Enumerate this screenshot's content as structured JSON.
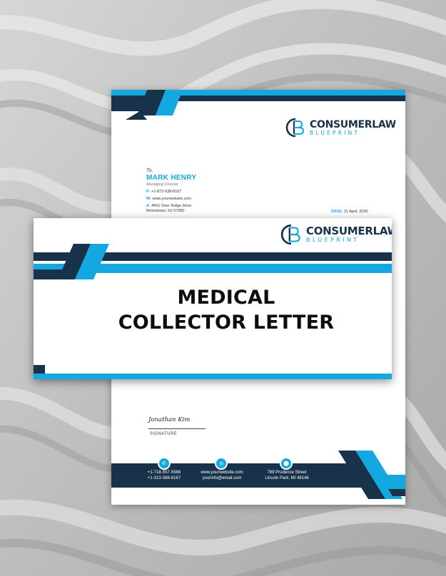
{
  "brand": {
    "name_line1": "CONSUMERLAW",
    "name_line2": "BLUEPRINT",
    "monogram": "CB"
  },
  "colors": {
    "accent": "#13a9e0",
    "navy": "#17324a",
    "background": "#b9b9b9"
  },
  "letter": {
    "to_label": "To,",
    "recipient_name": "MARK HENRY",
    "recipient_role": "Managing Director",
    "phone_prefix": "P:",
    "phone": "+1-873-638-8167",
    "web_prefix": "W:",
    "website": "www.yourwebsite.com",
    "address_prefix": "A:",
    "address_line1": "4561 Deer Ridge Drive",
    "address_line2": "Morristown, NJ 07960",
    "date_label": "DATE:",
    "date_value": "21 April, 2030",
    "signature_script": "Jonathan Kim",
    "signature_label": "SIGNATURE"
  },
  "footer": {
    "phone_line1": "+1-718-557-5588",
    "phone_line2": "+1-313-388-8167",
    "web_line1": "www.yourwebsite.com",
    "web_line2": "yourinfo@email.com",
    "addr_line1": "789 Prudence Street",
    "addr_line2": "Lincoln Park, MI 48146",
    "icons": [
      "phone-icon",
      "globe-icon",
      "location-icon"
    ]
  },
  "banner": {
    "title_line1": "MEDICAL",
    "title_line2": "COLLECTOR LETTER"
  }
}
